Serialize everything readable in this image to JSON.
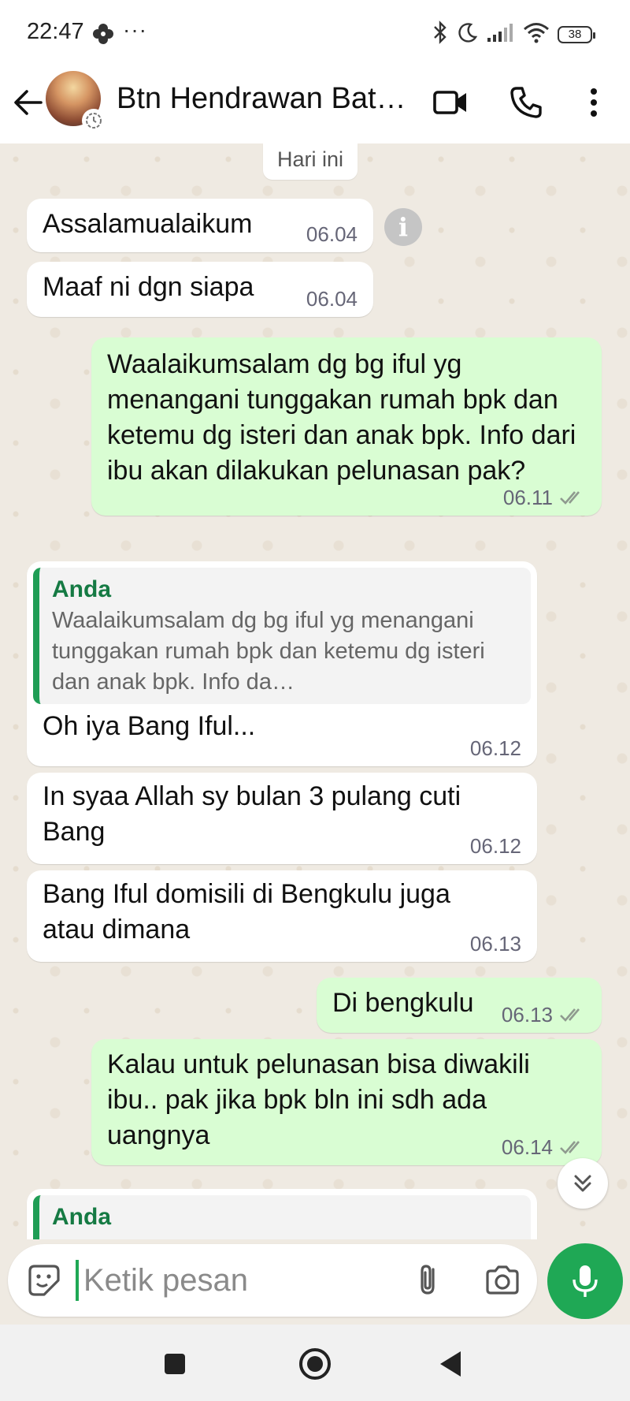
{
  "status_bar": {
    "time": "22:47",
    "dots": "···",
    "battery": "38",
    "icons": [
      "app-flower-icon",
      "bluetooth-icon",
      "moon-icon",
      "signal-icon",
      "wifi-icon",
      "battery-icon"
    ]
  },
  "header": {
    "contact_name": "Btn Hendrawan Bat…",
    "icons": [
      "back-arrow-icon",
      "video-call-icon",
      "phone-call-icon",
      "more-vert-icon"
    ]
  },
  "chat": {
    "date_divider": "Hari ini",
    "messages": [
      {
        "direction": "in",
        "text": "Assalamualaikum",
        "time": "06.04"
      },
      {
        "direction": "in",
        "text": "Maaf ni dgn siapa",
        "time": "06.04"
      },
      {
        "direction": "out",
        "text": "Waalaikumsalam dg bg iful yg menangani tunggakan rumah bpk dan ketemu dg isteri dan anak bpk. Info dari ibu akan dilakukan pelunasan pak?",
        "time": "06.11",
        "status": "read"
      },
      {
        "direction": "in",
        "quote_author": "Anda",
        "quote_text": "Waalaikumsalam dg bg iful yg menangani tunggakan rumah bpk dan ketemu dg isteri dan anak bpk. Info da…",
        "text": "Oh iya Bang Iful...",
        "time": "06.12"
      },
      {
        "direction": "in",
        "text": "In syaa Allah sy bulan 3 pulang cuti Bang",
        "time": "06.12"
      },
      {
        "direction": "in",
        "text": "Bang Iful domisili di Bengkulu juga atau dimana",
        "time": "06.13"
      },
      {
        "direction": "out",
        "text": "Di bengkulu",
        "time": "06.13",
        "status": "read"
      },
      {
        "direction": "out",
        "text": "Kalau untuk pelunasan bisa diwakili ibu.. pak jika bpk bln ini sdh ada uangnya",
        "time": "06.14",
        "status": "read"
      },
      {
        "direction": "in",
        "quote_author": "Anda",
        "partial": true
      }
    ]
  },
  "composer": {
    "placeholder": "Ketik pesan",
    "value": "",
    "icons": [
      "emoji-icon",
      "attach-icon",
      "camera-icon",
      "mic-icon"
    ]
  },
  "colors": {
    "accent": "#1fa855",
    "outgoing_bubble": "#d9fdd3",
    "incoming_bubble": "#ffffff",
    "chat_background": "#efeae2",
    "quote_author": "#157a43"
  }
}
